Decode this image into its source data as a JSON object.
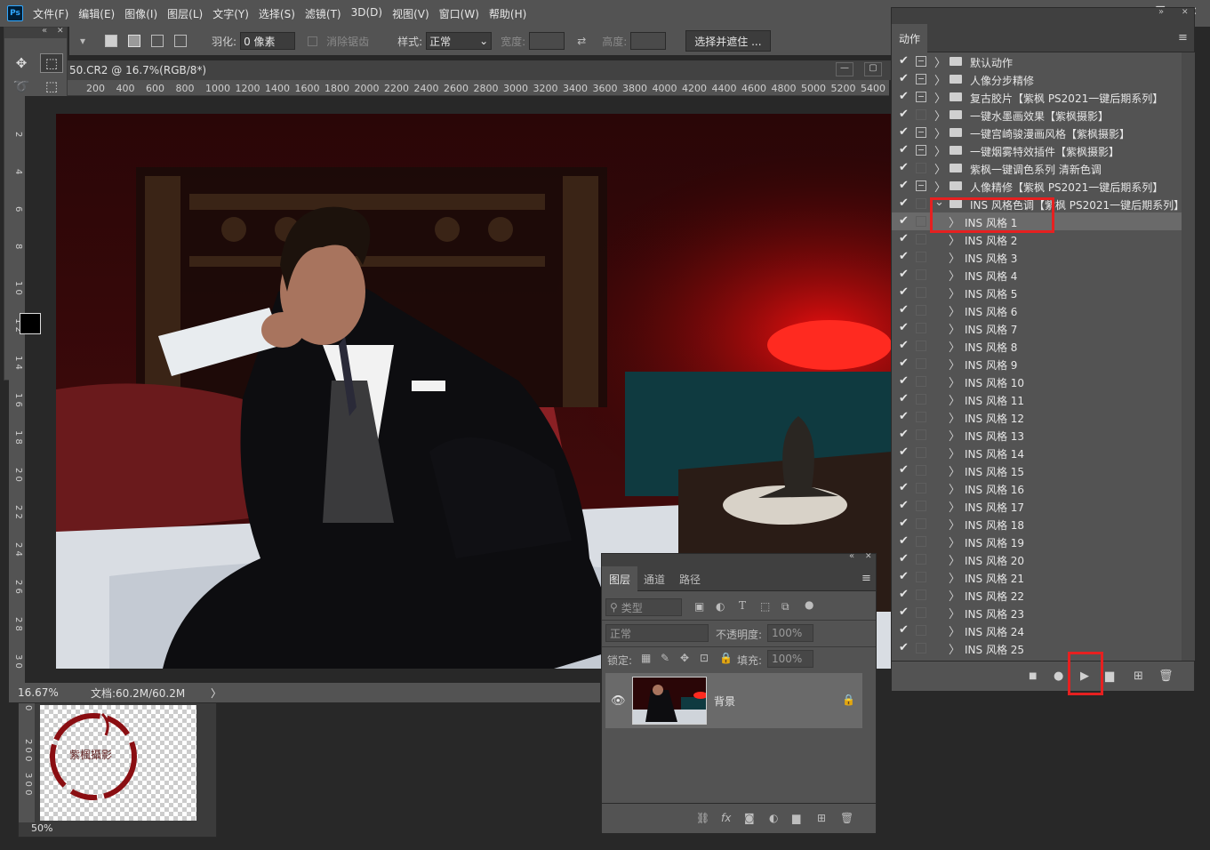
{
  "app": {
    "logo": "Ps",
    "accent": "#31a8ff",
    "highlight_color": "#e62020"
  },
  "menu": [
    "文件(F)",
    "编辑(E)",
    "图像(I)",
    "图层(L)",
    "文字(Y)",
    "选择(S)",
    "滤镜(T)",
    "3D(D)",
    "视图(V)",
    "窗口(W)",
    "帮助(H)"
  ],
  "options": {
    "feather_label": "羽化:",
    "feather_value": "0 像素",
    "antialias_label": "消除锯齿",
    "style_label": "样式:",
    "style_value": "正常",
    "width_label": "宽度:",
    "height_label": "高度:",
    "select_mask_button": "选择并遮住 ..."
  },
  "document": {
    "tab_title": "50.CR2 @ 16.7%(RGB/8*)",
    "ruler_ticks": [
      "200",
      "400",
      "600",
      "800",
      "1000",
      "1200",
      "1400",
      "1600",
      "1800",
      "2000",
      "2200",
      "2400",
      "2600",
      "2800",
      "3000",
      "3200",
      "3400",
      "3600",
      "3800",
      "4000",
      "4200",
      "4400",
      "4600",
      "4800",
      "5000",
      "5200",
      "5400"
    ],
    "left_ruler_ticks": [
      "2",
      "4",
      "6",
      "8",
      "1 0",
      "1 2",
      "1 4",
      "1 6",
      "1 8",
      "2 0",
      "2 2",
      "2 4",
      "2 6",
      "2 8",
      "3 0"
    ],
    "zoom": "16.67%",
    "doc_size": "文档:60.2M/60.2M"
  },
  "navigator": {
    "zoom": "50%",
    "ruler_ticks": [
      "0",
      "2 0 0",
      "3 0 0"
    ],
    "logo_text": "紫楓攝影"
  },
  "actions": {
    "tab": "动作",
    "rows": [
      {
        "label": "默认动作",
        "level": 0,
        "dialog": true
      },
      {
        "label": "人像分步精修",
        "level": 0,
        "dialog": true
      },
      {
        "label": "复古胶片【紫枫 PS2021一键后期系列】",
        "level": 0,
        "dialog": true
      },
      {
        "label": "一键水墨画效果【紫枫摄影】",
        "level": 0,
        "dialog": false
      },
      {
        "label": "一键宫崎骏漫画风格【紫枫摄影】",
        "level": 0,
        "dialog": true
      },
      {
        "label": "一键烟雾特效插件【紫枫摄影】",
        "level": 0,
        "dialog": true
      },
      {
        "label": "紫枫一键调色系列 清新色调",
        "level": 0,
        "dialog": false
      },
      {
        "label": "人像精修【紫枫 PS2021一键后期系列】",
        "level": 0,
        "dialog": true
      },
      {
        "label": "INS 风格色调【紫枫 PS2021一键后期系列】",
        "level": 0,
        "dialog": false,
        "expanded": true
      },
      {
        "label": "INS 风格   1",
        "level": 1,
        "dialog": false,
        "selected": true
      },
      {
        "label": "INS 风格   2",
        "level": 1,
        "dialog": false
      },
      {
        "label": "INS 风格   3",
        "level": 1,
        "dialog": false
      },
      {
        "label": "INS 风格   4",
        "level": 1,
        "dialog": false
      },
      {
        "label": "INS 风格   5",
        "level": 1,
        "dialog": false
      },
      {
        "label": "INS 风格   6",
        "level": 1,
        "dialog": false
      },
      {
        "label": "INS 风格   7",
        "level": 1,
        "dialog": false
      },
      {
        "label": "INS 风格   8",
        "level": 1,
        "dialog": false
      },
      {
        "label": "INS 风格   9",
        "level": 1,
        "dialog": false
      },
      {
        "label": "INS 风格   10",
        "level": 1,
        "dialog": false
      },
      {
        "label": "INS 风格   11",
        "level": 1,
        "dialog": false
      },
      {
        "label": "INS 风格   12",
        "level": 1,
        "dialog": false
      },
      {
        "label": "INS 风格   13",
        "level": 1,
        "dialog": false
      },
      {
        "label": "INS 风格   14",
        "level": 1,
        "dialog": false
      },
      {
        "label": "INS 风格   15",
        "level": 1,
        "dialog": false
      },
      {
        "label": "INS 风格   16",
        "level": 1,
        "dialog": false
      },
      {
        "label": "INS 风格   17",
        "level": 1,
        "dialog": false
      },
      {
        "label": "INS 风格   18",
        "level": 1,
        "dialog": false
      },
      {
        "label": "INS 风格   19",
        "level": 1,
        "dialog": false
      },
      {
        "label": "INS 风格   20",
        "level": 1,
        "dialog": false
      },
      {
        "label": "INS 风格   21",
        "level": 1,
        "dialog": false
      },
      {
        "label": "INS 风格   22",
        "level": 1,
        "dialog": false
      },
      {
        "label": "INS 风格   23",
        "level": 1,
        "dialog": false
      },
      {
        "label": "INS 风格   24",
        "level": 1,
        "dialog": false
      },
      {
        "label": "INS 风格   25",
        "level": 1,
        "dialog": false
      }
    ]
  },
  "layers": {
    "tabs": [
      "图层",
      "通道",
      "路径"
    ],
    "filter_placeholder": "类型",
    "blend_mode": "正常",
    "opacity_label": "不透明度:",
    "opacity_value": "100%",
    "lock_label": "锁定:",
    "fill_label": "填充:",
    "fill_value": "100%",
    "layer_name": "背景",
    "fx_label": "fx"
  }
}
